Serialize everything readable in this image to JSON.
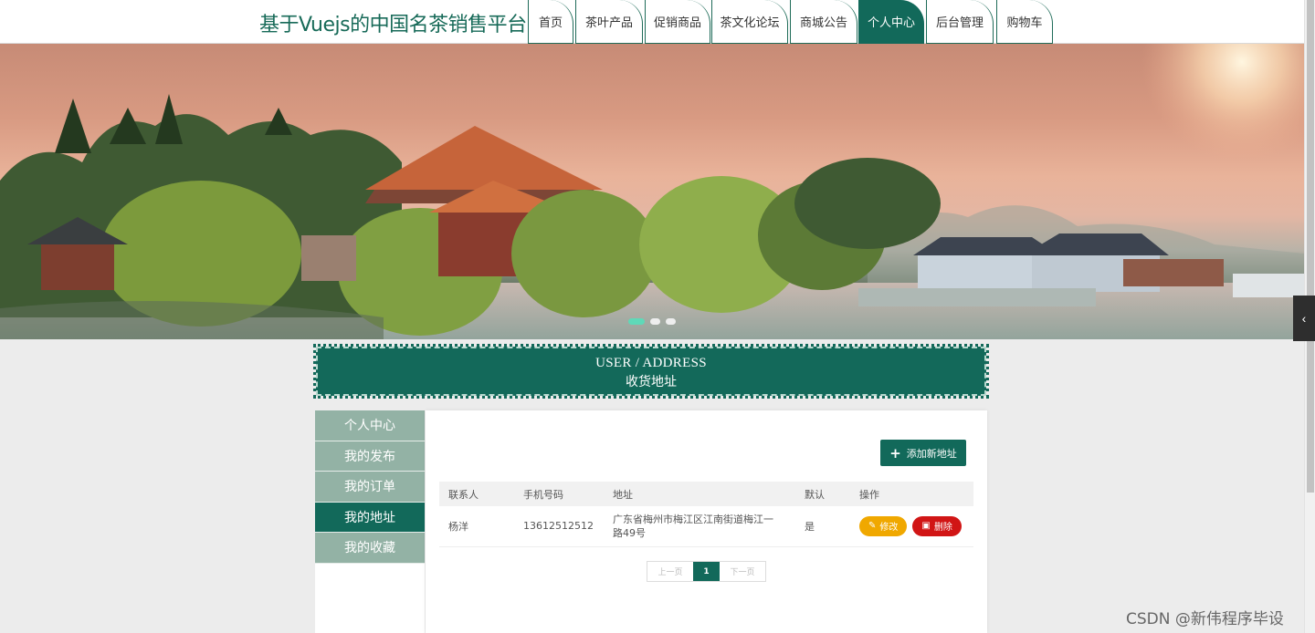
{
  "site": {
    "title": "基于Vuejs的中国名茶销售平台"
  },
  "nav": {
    "items": [
      {
        "label": "首页"
      },
      {
        "label": "茶叶产品"
      },
      {
        "label": "促销商品"
      },
      {
        "label": "茶文化论坛"
      },
      {
        "label": "商城公告"
      },
      {
        "label": "个人中心",
        "active": true
      },
      {
        "label": "后台管理"
      },
      {
        "label": "购物车"
      }
    ]
  },
  "banner": {
    "slides": 3,
    "active_slide": 1
  },
  "section": {
    "title_en": "USER / ADDRESS",
    "title_zh": "收货地址"
  },
  "sidebar": {
    "items": [
      {
        "label": "个人中心"
      },
      {
        "label": "我的发布"
      },
      {
        "label": "我的订单"
      },
      {
        "label": "我的地址",
        "active": true
      },
      {
        "label": "我的收藏"
      }
    ]
  },
  "toolbar": {
    "add_label": "添加新地址"
  },
  "table": {
    "headers": [
      "联系人",
      "手机号码",
      "地址",
      "默认",
      "操作"
    ],
    "rows": [
      {
        "contact": "杨洋",
        "phone": "13612512512",
        "address": "广东省梅州市梅江区江南街道梅江一路49号",
        "default": "是",
        "edit_label": "修改",
        "delete_label": "删除"
      }
    ]
  },
  "pagination": {
    "prev_label": "上一页",
    "current": "1",
    "next_label": "下一页"
  },
  "colors": {
    "primary": "#12695a",
    "edit": "#f0a800",
    "delete": "#d11515",
    "sidebar": "#93b2a5"
  },
  "watermark": "CSDN @新伟程序毕设"
}
